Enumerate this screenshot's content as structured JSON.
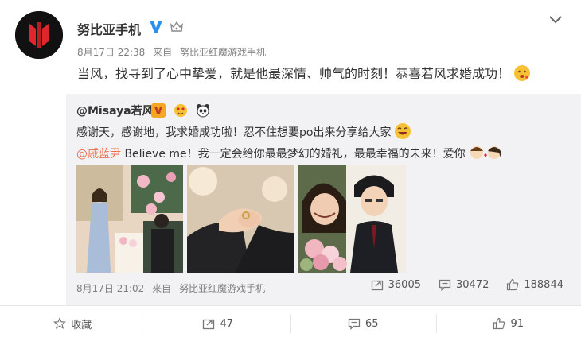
{
  "author": {
    "name": "努比亚手机",
    "avatar_icon": "red-magic-logo-icon",
    "verified_icon": "verified-v-icon",
    "member_icon": "crown-icon"
  },
  "post": {
    "time": "8月17日 22:38",
    "source_prefix": "来自",
    "source": "努比亚红魔游戏手机",
    "text": "当风，找寻到了心中挚爱，就是他最深情、帅气的时刻！恭喜若风求婚成功！",
    "emoji": "drooling-face-icon"
  },
  "repost": {
    "user": "@Misaya若风",
    "badges": [
      "verified-v-orange-icon",
      "love-face-icon",
      "panda-icon"
    ],
    "text1": "感谢天，感谢地，我求婚成功啦！忍不住想要po出来分享给大家",
    "mention": "@戚蓝尹",
    "text2": " Believe me！我一定会给你最最梦幻的婚礼，最最幸福的未来！爱你",
    "time": "8月17日 21:02",
    "source_prefix": "来自",
    "source": "努比亚红魔游戏手机",
    "shares": "36005",
    "comments": "30472",
    "likes": "188844"
  },
  "actions": {
    "favorite": "收藏",
    "forward": "47",
    "comment": "65",
    "like": "91"
  },
  "colors": {
    "accent": "#eb7350",
    "verified": "#2d8ff0",
    "meta": "#808080"
  }
}
